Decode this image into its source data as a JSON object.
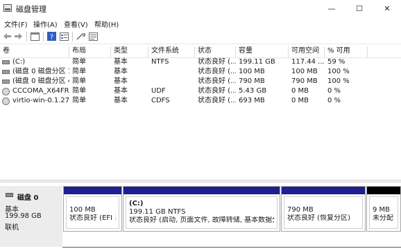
{
  "window": {
    "title": "磁盘管理",
    "minimize": "—",
    "maximize": "☐",
    "close": "✕"
  },
  "menu": [
    "文件(F)",
    "操作(A)",
    "查看(V)",
    "帮助(H)"
  ],
  "columns": [
    "卷",
    "布局",
    "类型",
    "文件系统",
    "状态",
    "容量",
    "可用空间",
    "% 可用"
  ],
  "volumes": [
    {
      "name": "(C:)",
      "layout": "简单",
      "type": "基本",
      "fs": "NTFS",
      "status": "状态良好 (...",
      "capacity": "199.11 GB",
      "free": "117.44 ...",
      "pct": "59 %",
      "icon": "drive-icon"
    },
    {
      "name": "(磁盘 0 磁盘分区 1)",
      "layout": "简单",
      "type": "基本",
      "fs": "",
      "status": "状态良好 (...",
      "capacity": "100 MB",
      "free": "100 MB",
      "pct": "100 %",
      "icon": "drive-icon"
    },
    {
      "name": "(磁盘 0 磁盘分区 4)",
      "layout": "简单",
      "type": "基本",
      "fs": "",
      "status": "状态良好 (...",
      "capacity": "790 MB",
      "free": "790 MB",
      "pct": "100 %",
      "icon": "drive-icon"
    },
    {
      "name": "CCCOMA_X64FR...",
      "layout": "简单",
      "type": "基本",
      "fs": "UDF",
      "status": "状态良好 (...",
      "capacity": "5.43 GB",
      "free": "0 MB",
      "pct": "0 %",
      "icon": "cd-icon"
    },
    {
      "name": "virtio-win-0.1.27...",
      "layout": "简单",
      "type": "基本",
      "fs": "CDFS",
      "status": "状态良好 (...",
      "capacity": "693 MB",
      "free": "0 MB",
      "pct": "0 %",
      "icon": "cd-icon"
    }
  ],
  "disk": {
    "name": "磁盘 0",
    "type": "基本",
    "size": "199.98 GB",
    "state": "联机"
  },
  "partitions": [
    {
      "line1": "100 MB",
      "line2": "状态良好 (EFI 系统分区)",
      "bar": "#1f1f8f"
    },
    {
      "title": "(C:)",
      "line1": "199.11 GB NTFS",
      "line2": "状态良好 (启动, 页面文件, 故障转储, 基本数据分区)",
      "bar": "#1f1f8f"
    },
    {
      "line1": "790 MB",
      "line2": "状态良好 (恢复分区)",
      "bar": "#1f1f8f"
    },
    {
      "line1": "9 MB",
      "line2": "未分配",
      "bar": "#000000"
    }
  ]
}
